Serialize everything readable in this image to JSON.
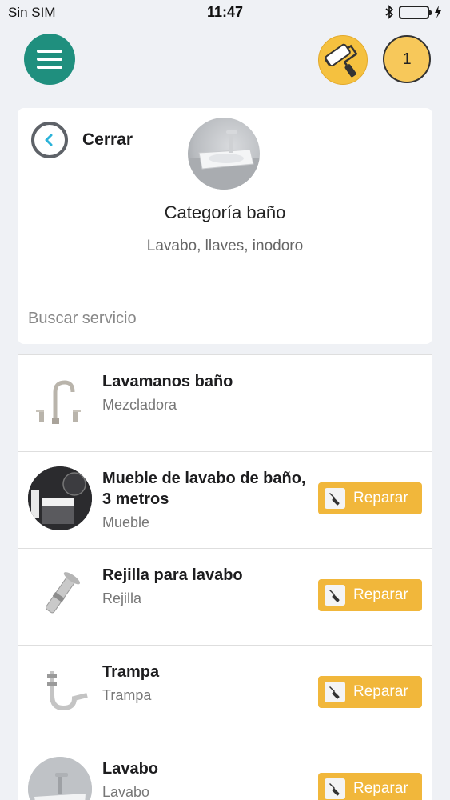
{
  "status_bar": {
    "carrier": "Sin SIM",
    "time": "11:47"
  },
  "header": {
    "menu_icon": "hamburger-menu-icon",
    "tool_icon": "paint-roller-icon",
    "cart_count": "1"
  },
  "category": {
    "back_label": "Cerrar",
    "title": "Categoría baño",
    "subtitle": "Lavabo, llaves, inodoro",
    "search_placeholder": "Buscar servicio"
  },
  "services": [
    {
      "name": "Lavamanos baño",
      "subtitle": "Mezcladora",
      "action": ""
    },
    {
      "name": "Mueble de lavabo de baño, 3 metros",
      "subtitle": "Mueble",
      "action": "Reparar"
    },
    {
      "name": "Rejilla para lavabo",
      "subtitle": "Rejilla",
      "action": "Reparar"
    },
    {
      "name": "Trampa",
      "subtitle": "Trampa",
      "action": "Reparar"
    },
    {
      "name": "Lavabo",
      "subtitle": "Lavabo",
      "action": "Reparar"
    }
  ],
  "colors": {
    "accent_teal": "#1f8f7e",
    "accent_yellow": "#f1b73b",
    "back_arrow": "#2bb3d9"
  }
}
